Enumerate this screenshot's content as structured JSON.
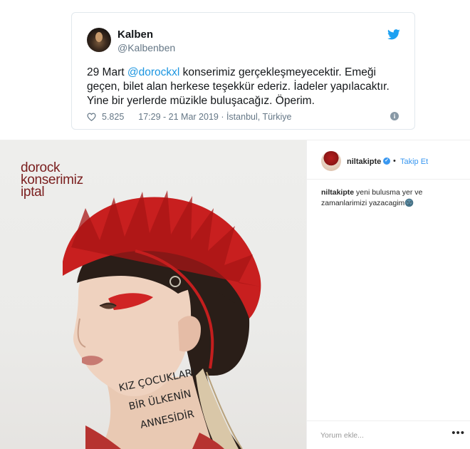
{
  "tweet": {
    "name": "Kalben",
    "handle": "@Kalbenben",
    "text_before": "29 Mart ",
    "mention": "@dorockxl",
    "text_after": " konserimiz gerçekleşmeyecektir. Emeği geçen, bilet alan herkese teşekkür ederiz. İadeler yapılacaktır. Yine bir yerlerde müzikle buluşacağız. Öperim.",
    "likes": "5.825",
    "timestamp": "17:29 - 21 Mar 2019 · İstanbul, Türkiye",
    "icons": {
      "bird": "twitter-bird-icon",
      "heart": "heart-icon",
      "info": "info-icon"
    },
    "colors": {
      "accent": "#1da1f2",
      "mention": "#1b95e0",
      "muted": "#657786"
    }
  },
  "instagram": {
    "photo_caption": [
      "dorock",
      "konserimiz",
      "iptal"
    ],
    "neck_text": [
      "KIZ ÇOCUKLARI",
      "BİR ÜLKENİN",
      "ANNESİDİR"
    ],
    "username": "niltakipte",
    "follow_label": "Takip Et",
    "separator": "•",
    "comment_user": "niltakipte",
    "comment_text": " yeni bulusma yer ve zamanlarimizi yazacagim🌚",
    "add_comment_placeholder": "Yorum ekle...",
    "more_label": "•••",
    "colors": {
      "follow": "#3897f0",
      "caption": "#7a1e1e",
      "verified": "#3897f0"
    }
  }
}
